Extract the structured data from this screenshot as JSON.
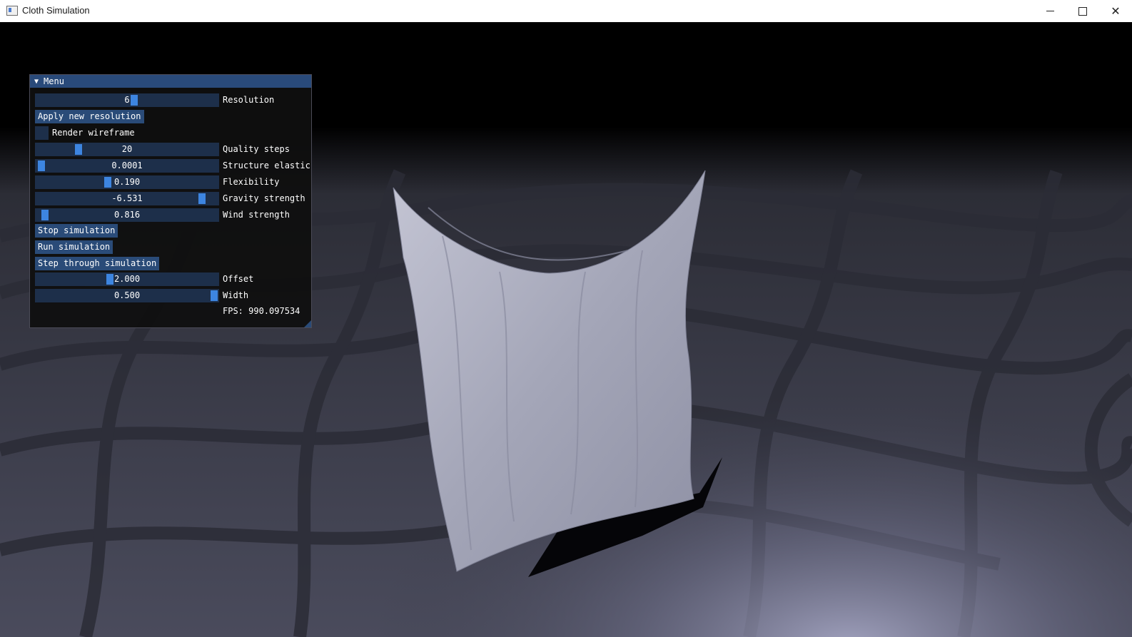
{
  "window": {
    "title": "Cloth Simulation"
  },
  "menu": {
    "title": "Menu",
    "resolution": {
      "value": "6",
      "label": "Resolution",
      "fraction": 0.54
    },
    "apply_button": "Apply new resolution",
    "wireframe": {
      "label": "Render wireframe",
      "checked": false
    },
    "quality_steps": {
      "value": "20",
      "label": "Quality steps",
      "fraction": 0.22
    },
    "structure_elasticity": {
      "value": "0.0001",
      "label": "Structure elastici",
      "fraction": 0.01
    },
    "flexibility": {
      "value": "0.190",
      "label": "Flexibility",
      "fraction": 0.39
    },
    "gravity_strength": {
      "value": "-6.531",
      "label": "Gravity strength",
      "fraction": 0.93
    },
    "wind_strength": {
      "value": "0.816",
      "label": "Wind strength",
      "fraction": 0.03
    },
    "stop_button": "Stop simulation",
    "run_button": "Run simulation",
    "step_button": "Step through simulation",
    "offset": {
      "value": "2.000",
      "label": "Offset",
      "fraction": 0.4
    },
    "width": {
      "value": "0.500",
      "label": "Width",
      "fraction": 1.0
    },
    "fps_text": "FPS: 990.097534"
  },
  "colors": {
    "title_bar_active": "#294a7a",
    "slider_bg": "#1d2f4a",
    "slider_grab": "#3d85e0",
    "button": "#2a4b78",
    "cloth": "#a9abbd",
    "floor": "#3b3c49"
  }
}
